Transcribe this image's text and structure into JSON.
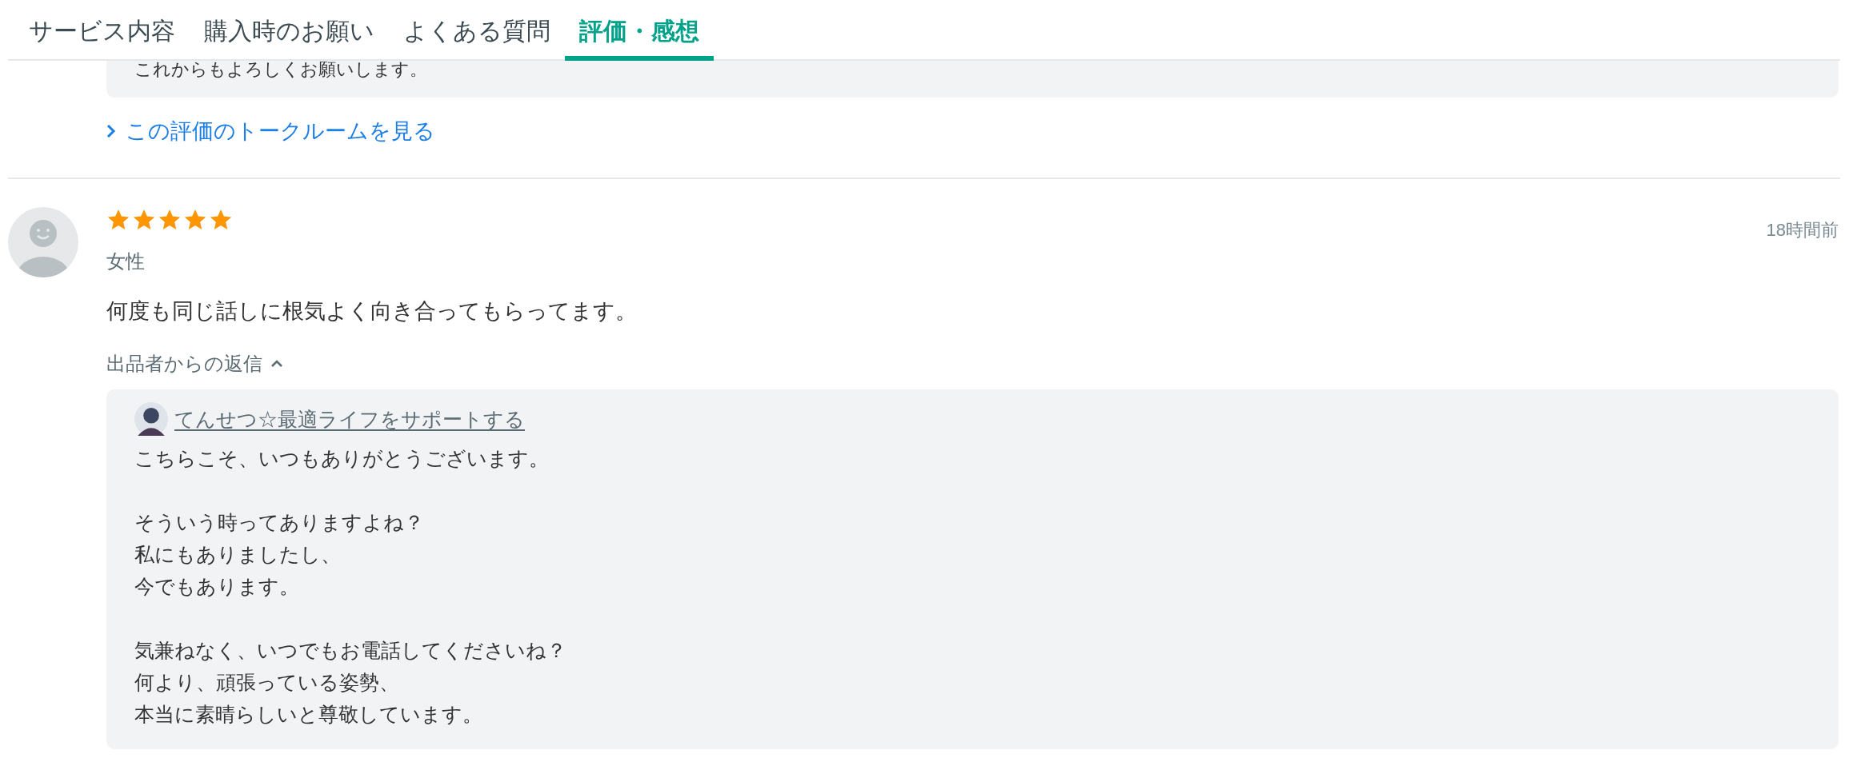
{
  "tabs": [
    {
      "label": "サービス内容",
      "selected": false
    },
    {
      "label": "購入時のお願い",
      "selected": false
    },
    {
      "label": "よくある質問",
      "selected": false
    },
    {
      "label": "評価・感想",
      "selected": true
    }
  ],
  "previous_review": {
    "reply_tail": "これからもよろしくお願いします。",
    "talkroom_link": "この評価のトークルームを見る"
  },
  "review": {
    "stars": 5,
    "time": "18時間前",
    "gender": "女性",
    "comment": "何度も同じ話しに根気よく向き合ってもらってます。",
    "reply_toggle": {
      "label": "出品者からの返信",
      "expanded": true
    },
    "reply": {
      "author": "てんせつ☆最適ライフをサポートする",
      "paragraphs": [
        [
          "こちらこそ、いつもありがとうございます。"
        ],
        [
          "そういう時ってありますよね？",
          "私にもありましたし、",
          "今でもあります。"
        ],
        [
          "気兼ねなく、いつでもお電話してくださいね？",
          "何より、頑張っている姿勢、",
          "本当に素晴らしいと尊敬しています。"
        ]
      ]
    }
  }
}
